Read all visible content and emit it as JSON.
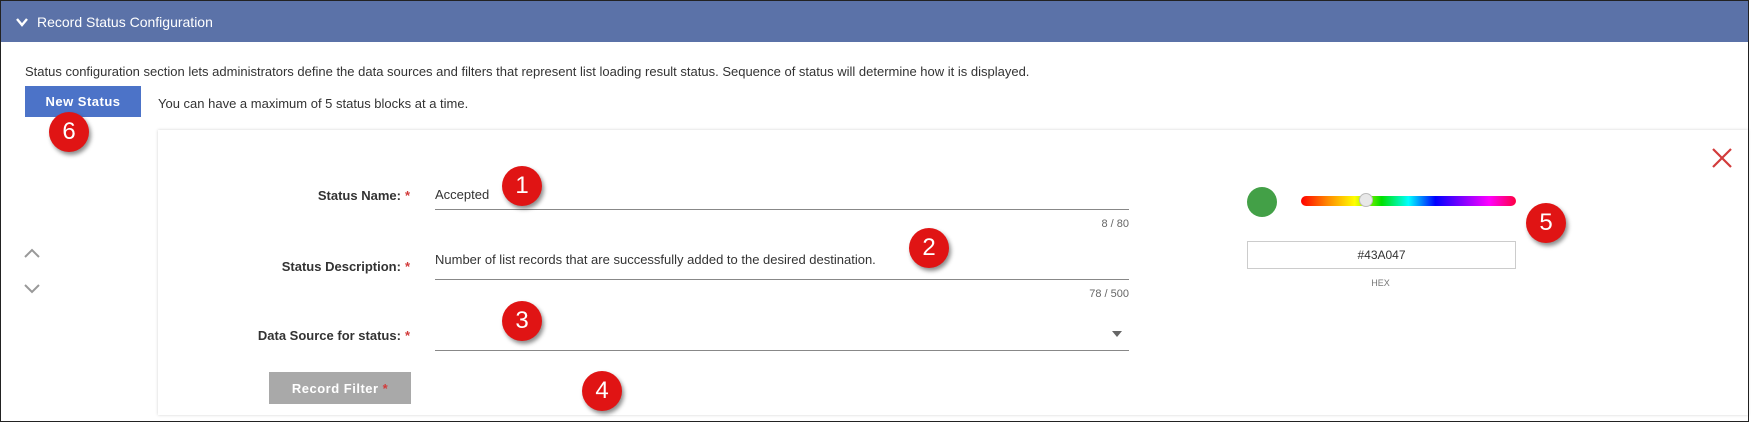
{
  "header": {
    "title": "Record Status Configuration",
    "icon": "chevron-down-icon"
  },
  "intro_text": "Status configuration section lets administrators define the data sources and filters that represent list loading result status. Sequence of status will determine how it is displayed.",
  "new_status_label": "New Status",
  "max_note": "You can have a maximum of 5 status blocks at a time.",
  "status_name": {
    "label": "Status Name:",
    "required": "*",
    "value": "Accepted",
    "counter": "8 / 80"
  },
  "status_description": {
    "label": "Status Description:",
    "required": "*",
    "value": "Number of list records that are successfully added to the desired destination.",
    "counter": "78 / 500"
  },
  "data_source": {
    "label": "Data Source for status:",
    "required": "*",
    "value": ""
  },
  "record_filter": {
    "label": "Record Filter",
    "required": "*"
  },
  "color": {
    "hex": "#43A047",
    "hex_label": "HEX",
    "hue_position": 0.3
  },
  "badges": [
    "1",
    "2",
    "3",
    "4",
    "5",
    "6"
  ],
  "colors": {
    "header_bg": "#5b72a8",
    "primary_button": "#4c73c8",
    "disabled_button": "#a9a9a9",
    "required": "#d23b3b",
    "badge": "#e01414",
    "close": "#d23b3b"
  }
}
